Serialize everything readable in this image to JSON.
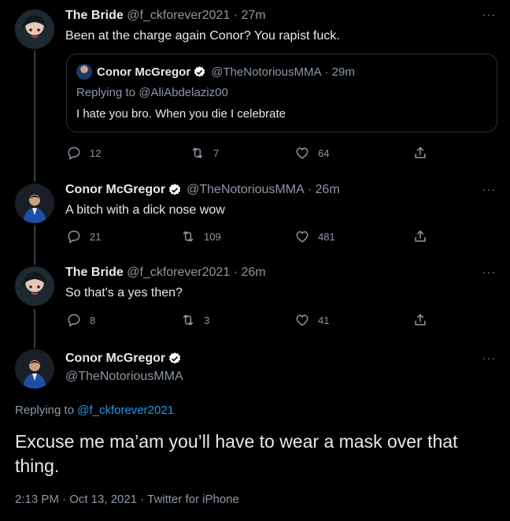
{
  "tweets": [
    {
      "name": "The Bride",
      "handle": "@f_ckforever2021",
      "time": "· 27m",
      "text": "Been at the charge again Conor? You rapist fuck.",
      "reply_count": "12",
      "retweet_count": "7",
      "like_count": "64"
    },
    {
      "name": "Conor McGregor",
      "handle": "@TheNotoriousMMA",
      "time": "· 26m",
      "text": "A bitch with a dick nose wow",
      "reply_count": "21",
      "retweet_count": "109",
      "like_count": "481"
    },
    {
      "name": "The Bride",
      "handle": "@f_ckforever2021",
      "time": "· 26m",
      "text": "So that's a yes then?",
      "reply_count": "8",
      "retweet_count": "3",
      "like_count": "41"
    }
  ],
  "quote": {
    "name": "Conor McGregor",
    "handle": "@TheNotoriousMMA",
    "time": "· 29m",
    "replying_prefix": "Replying to",
    "replying_handle": "@AliAbdelaziz00",
    "text": "I hate you bro. When you die I celebrate"
  },
  "main_tweet": {
    "name": "Conor McGregor",
    "handle": "@TheNotoriousMMA",
    "replying_prefix": "Replying to",
    "replying_handle": "@f_ckforever2021",
    "text": "Excuse me ma’am you’ll have to wear a mask over that thing.",
    "timestamp": "2:13 PM · Oct 13, 2021 · Twitter for iPhone"
  },
  "more_icon": "···",
  "colors": {
    "background": "#000000",
    "text": "#e7e9ea",
    "secondary": "#8b98a5",
    "link": "#1d9bf0",
    "verified": "#ffffff"
  },
  "icons": [
    "reply-icon",
    "retweet-icon",
    "like-icon",
    "share-icon",
    "verified-icon",
    "more-icon"
  ]
}
